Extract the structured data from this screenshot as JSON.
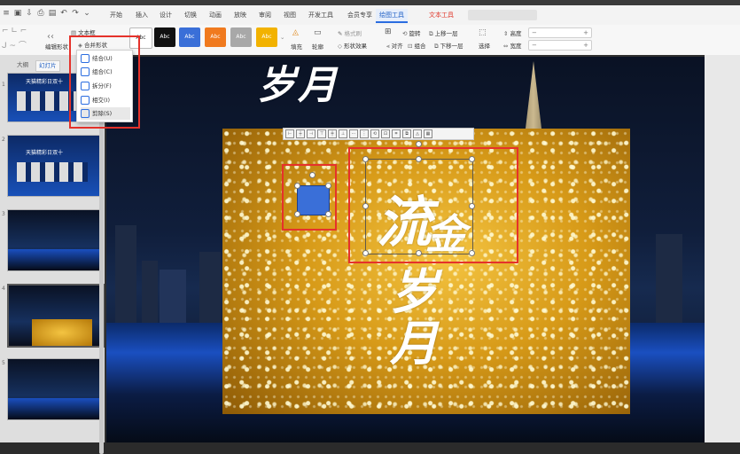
{
  "tabs": [
    "开始",
    "插入",
    "设计",
    "切换",
    "动画",
    "放映",
    "审阅",
    "视图",
    "开发工具",
    "会员专享",
    "绘图工具",
    "文本工具"
  ],
  "ribbon": {
    "textbox_label": "文本框",
    "edit_shape_label": "编辑形状",
    "merge_shape_label": "合并形状",
    "style_label": "Abc",
    "fill_label": "填充",
    "outline_label": "轮廓",
    "effect_label": "形状效果",
    "format_brush_label": "格式刷",
    "rotate_label": "旋转",
    "group_label": "组合",
    "align_label": "对齐",
    "bring_forward_label": "上移一层",
    "send_backward_label": "下移一层",
    "select_label": "选择",
    "height_label": "高度",
    "width_label": "宽度"
  },
  "style_colors": [
    "#ffffff",
    "#111111",
    "#3a6fd8",
    "#f07a1f",
    "#a8a8a8",
    "#f2b200"
  ],
  "panel": {
    "tabs": [
      "大纲",
      "幻灯片"
    ],
    "slide_numbers": [
      "1",
      "2",
      "3",
      "4",
      "5"
    ],
    "thumb1_title": "天猫精彩日双十",
    "thumb2_title": "天猫精彩日双十"
  },
  "menu": {
    "items": [
      {
        "label": "结合(U)",
        "icon": "union-icon"
      },
      {
        "label": "组合(C)",
        "icon": "combine-icon"
      },
      {
        "label": "拆分(F)",
        "icon": "fragment-icon"
      },
      {
        "label": "相交(I)",
        "icon": "intersect-icon"
      },
      {
        "label": "剪除(S)",
        "icon": "subtract-icon"
      }
    ]
  },
  "slide": {
    "top_text": "岁月",
    "main_text1": "流",
    "main_text2": "金",
    "bottom_text": "岁月"
  },
  "accent_red": "#e5322b",
  "accent_blue": "#3a6fd8"
}
